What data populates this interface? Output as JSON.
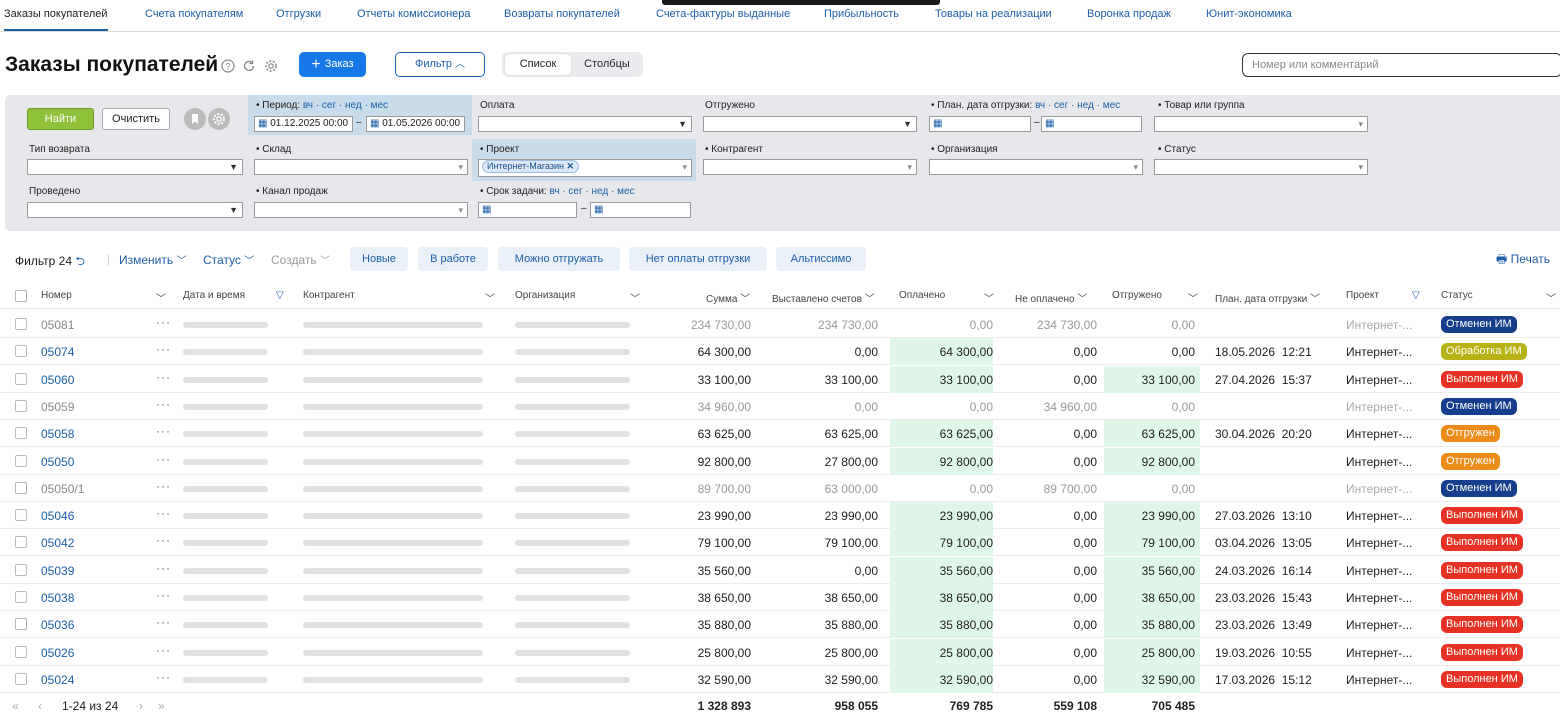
{
  "nav": {
    "tabs": [
      "Заказы покупателей",
      "Счета покупателям",
      "Отгрузки",
      "Отчеты комиссионера",
      "Возвраты покупателей",
      "Счета-фактуры выданные",
      "Прибыльность",
      "Товары на реализации",
      "Воронка продаж",
      "Юнит-экономика"
    ]
  },
  "page": {
    "title": "Заказы покупателей",
    "add_label": "Заказ",
    "filter_label": "Фильтр",
    "view_list": "Список",
    "view_columns": "Столбцы",
    "search_placeholder": "Номер или комментарий"
  },
  "filter": {
    "find": "Найти",
    "clear": "Очистить",
    "period_label": "Период:",
    "period_links": "вч · сег · нед · мес",
    "period_from": "01.12.2025 00:00",
    "period_to": "01.05.2026 00:00",
    "payment": "Оплата",
    "shipped": "Отгружено",
    "plan_ship_label": "План. дата отгрузки:",
    "plan_ship_links": "вч · сег · нед · мес",
    "goods": "Товар или группа",
    "return_type": "Тип возврата",
    "warehouse": "Склад",
    "project": "Проект",
    "project_tag": "Интернет-Магазин",
    "counterparty": "Контрагент",
    "organization": "Организация",
    "status": "Статус",
    "posted": "Проведено",
    "channel": "Канал продаж",
    "task_label": "Срок задачи:",
    "task_links": "вч · сег · нед · мес"
  },
  "actions": {
    "filter_count": "Фильтр 24",
    "edit": "Изменить",
    "status": "Статус",
    "create": "Создать",
    "chips": [
      "Новые",
      "В работе",
      "Можно отгружать",
      "Нет оплаты отгрузки",
      "Альтиссимо"
    ],
    "print": "Печать"
  },
  "columns": {
    "number": "Номер",
    "datetime": "Дата и время",
    "counterparty": "Контрагент",
    "organization": "Организация",
    "sum": "Сумма",
    "invoiced": "Выставлено счетов",
    "paid": "Оплачено",
    "unpaid": "Не оплачено",
    "shipped": "Отгружено",
    "plan_date": "План. дата отгрузки",
    "project": "Проект",
    "status": "Статус"
  },
  "rows": [
    {
      "number": "05081",
      "sum": "234 730,00",
      "invoiced": "234 730,00",
      "paid": "0,00",
      "unpaid": "234 730,00",
      "shipped": "0,00",
      "plan_date": "",
      "plan_time": "",
      "project": "Интернет-...",
      "status": "Отменен ИМ"
    },
    {
      "number": "05074",
      "sum": "64 300,00",
      "invoiced": "0,00",
      "paid": "64 300,00",
      "unpaid": "0,00",
      "shipped": "0,00",
      "plan_date": "18.05.2026",
      "plan_time": "12:21",
      "project": "Интернет-...",
      "status": "Обработка ИМ"
    },
    {
      "number": "05060",
      "sum": "33 100,00",
      "invoiced": "33 100,00",
      "paid": "33 100,00",
      "unpaid": "0,00",
      "shipped": "33 100,00",
      "plan_date": "27.04.2026",
      "plan_time": "15:37",
      "project": "Интернет-...",
      "status": "Выполнен ИМ"
    },
    {
      "number": "05059",
      "sum": "34 960,00",
      "invoiced": "0,00",
      "paid": "0,00",
      "unpaid": "34 960,00",
      "shipped": "0,00",
      "plan_date": "",
      "plan_time": "",
      "project": "Интернет-...",
      "status": "Отменен ИМ"
    },
    {
      "number": "05058",
      "sum": "63 625,00",
      "invoiced": "63 625,00",
      "paid": "63 625,00",
      "unpaid": "0,00",
      "shipped": "63 625,00",
      "plan_date": "30.04.2026",
      "plan_time": "20:20",
      "project": "Интернет-...",
      "status": "Отгружен"
    },
    {
      "number": "05050",
      "sum": "92 800,00",
      "invoiced": "27 800,00",
      "paid": "92 800,00",
      "unpaid": "0,00",
      "shipped": "92 800,00",
      "plan_date": "",
      "plan_time": "",
      "project": "Интернет-...",
      "status": "Отгружен"
    },
    {
      "number": "05050/1",
      "sum": "89 700,00",
      "invoiced": "63 000,00",
      "paid": "0,00",
      "unpaid": "89 700,00",
      "shipped": "0,00",
      "plan_date": "",
      "plan_time": "",
      "project": "Интернет-...",
      "status": "Отменен ИМ"
    },
    {
      "number": "05046",
      "sum": "23 990,00",
      "invoiced": "23 990,00",
      "paid": "23 990,00",
      "unpaid": "0,00",
      "shipped": "23 990,00",
      "plan_date": "27.03.2026",
      "plan_time": "13:10",
      "project": "Интернет-...",
      "status": "Выполнен ИМ"
    },
    {
      "number": "05042",
      "sum": "79 100,00",
      "invoiced": "79 100,00",
      "paid": "79 100,00",
      "unpaid": "0,00",
      "shipped": "79 100,00",
      "plan_date": "03.04.2026",
      "plan_time": "13:05",
      "project": "Интернет-...",
      "status": "Выполнен ИМ"
    },
    {
      "number": "05039",
      "sum": "35 560,00",
      "invoiced": "0,00",
      "paid": "35 560,00",
      "unpaid": "0,00",
      "shipped": "35 560,00",
      "plan_date": "24.03.2026",
      "plan_time": "16:14",
      "project": "Интернет-...",
      "status": "Выполнен ИМ"
    },
    {
      "number": "05038",
      "sum": "38 650,00",
      "invoiced": "38 650,00",
      "paid": "38 650,00",
      "unpaid": "0,00",
      "shipped": "38 650,00",
      "plan_date": "23.03.2026",
      "plan_time": "15:43",
      "project": "Интернет-...",
      "status": "Выполнен ИМ"
    },
    {
      "number": "05036",
      "sum": "35 880,00",
      "invoiced": "35 880,00",
      "paid": "35 880,00",
      "unpaid": "0,00",
      "shipped": "35 880,00",
      "plan_date": "23.03.2026",
      "plan_time": "13:49",
      "project": "Интернет-...",
      "status": "Выполнен ИМ"
    },
    {
      "number": "05026",
      "sum": "25 800,00",
      "invoiced": "25 800,00",
      "paid": "25 800,00",
      "unpaid": "0,00",
      "shipped": "25 800,00",
      "plan_date": "19.03.2026",
      "plan_time": "10:55",
      "project": "Интернет-...",
      "status": "Выполнен ИМ"
    },
    {
      "number": "05024",
      "sum": "32 590,00",
      "invoiced": "32 590,00",
      "paid": "32 590,00",
      "unpaid": "0,00",
      "shipped": "32 590,00",
      "plan_date": "17.03.2026",
      "plan_time": "15:12",
      "project": "Интернет-...",
      "status": "Выполнен ИМ"
    }
  ],
  "footer": {
    "pagination": "1-24 из 24",
    "total_sum": "1 328 893",
    "total_invoiced": "958 055",
    "total_paid": "769 785",
    "total_unpaid": "559 108",
    "total_shipped": "705 485"
  },
  "status_colors": {
    "Отменен ИМ": "#163e8c",
    "Обработка ИМ": "#b7b317",
    "Выполнен ИМ": "#e53224",
    "Отгружен": "#ec8a1a"
  },
  "colors": {
    "accent": "#1c5fa8",
    "primary_button": "#1677e6",
    "find_button": "#8fc13b",
    "paid_highlight": "#dff7e9"
  }
}
